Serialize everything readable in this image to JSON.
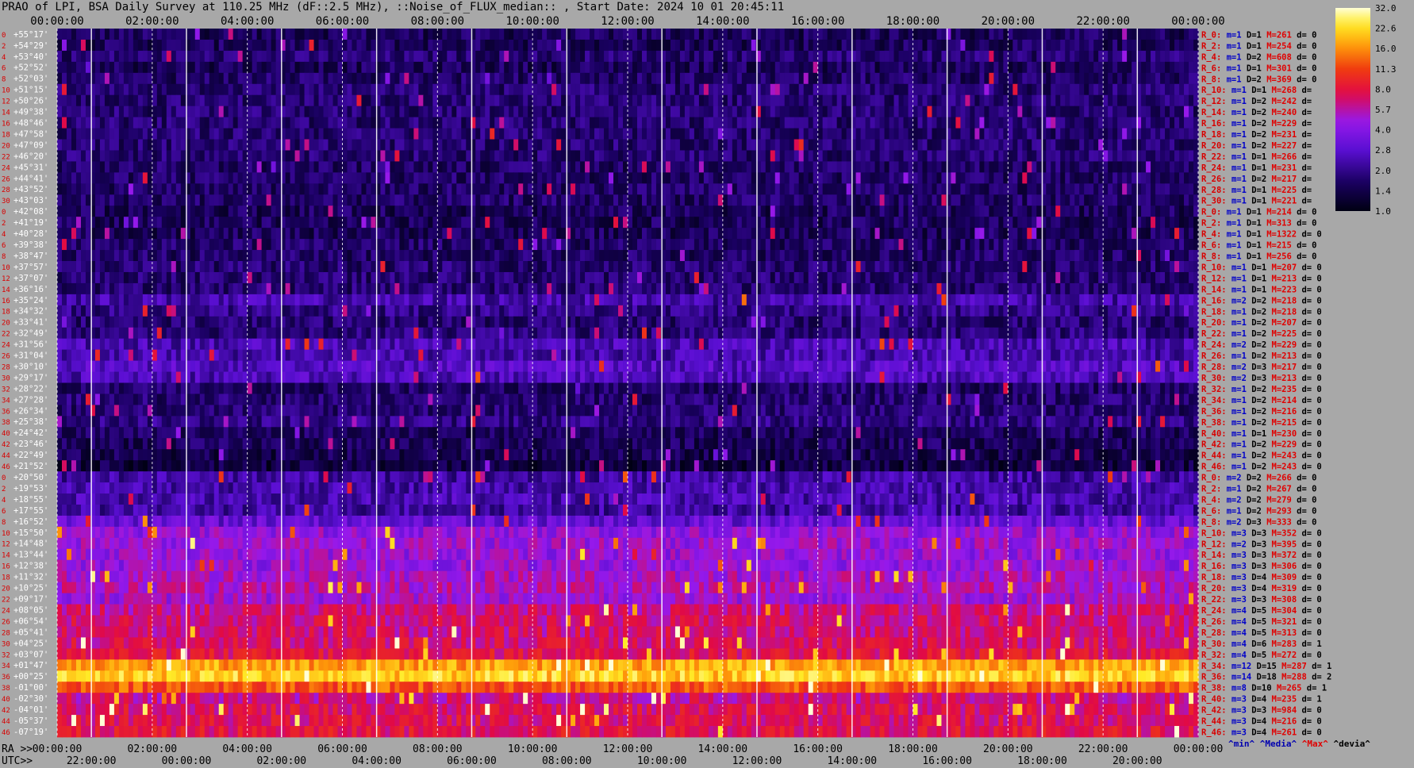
{
  "window_title": "PRAO of LPI, BSA Daily Survey at 110.25 MHz (dF::2.5 MHz), ::Noise_of_FLUX_median:: , Start Date: 2024 10 01 20:45:11",
  "chart_data": {
    "type": "heatmap",
    "title": "PRAO of LPI, BSA Daily Survey at 110.25 MHz (dF::2.5 MHz), ::Noise_of_FLUX_median:: , Start Date: 2024 10 01 20:45:11",
    "top_time_labels": [
      "00:00:00",
      "02:00:00",
      "04:00:00",
      "06:00:00",
      "08:00:00",
      "10:00:00",
      "12:00:00",
      "14:00:00",
      "16:00:00",
      "18:00:00",
      "20:00:00",
      "22:00:00",
      "00:00:00"
    ],
    "ra_axis_label": "RA >>",
    "ra_labels": [
      "00:00:00",
      "02:00:00",
      "04:00:00",
      "06:00:00",
      "08:00:00",
      "10:00:00",
      "12:00:00",
      "14:00:00",
      "16:00:00",
      "18:00:00",
      "20:00:00",
      "22:00:00",
      "00:00:00"
    ],
    "utc_axis_label": "UTC>>",
    "utc_labels": [
      "22:00:00",
      "00:00:00",
      "02:00:00",
      "04:00:00",
      "06:00:00",
      "08:00:00",
      "10:00:00",
      "12:00:00",
      "14:00:00",
      "16:00:00",
      "18:00:00",
      "20:00:00"
    ],
    "dec_labels": [
      "+55°17'",
      "+54°29'",
      "+53°40'",
      "+52°52'",
      "+52°03'",
      "+51°15'",
      "+50°26'",
      "+49°38'",
      "+48°46'",
      "+47°58'",
      "+47°09'",
      "+46°20'",
      "+45°31'",
      "+44°41'",
      "+43°52'",
      "+43°03'",
      "+42°08'",
      "+41°19'",
      "+40°28'",
      "+39°38'",
      "+38°47'",
      "+37°57'",
      "+37°07'",
      "+36°16'",
      "+35°24'",
      "+34°32'",
      "+33°41'",
      "+32°49'",
      "+31°56'",
      "+31°04'",
      "+30°10'",
      "+29°17'",
      "+28°22'",
      "+27°28'",
      "+26°34'",
      "+25°38'",
      "+24°42'",
      "+23°46'",
      "+22°49'",
      "+21°52'",
      "+20°50'",
      "+19°53'",
      "+18°55'",
      "+17°55'",
      "+16°52'",
      "+15°50'",
      "+14°48'",
      "+13°44'",
      "+12°38'",
      "+11°32'",
      "+10°25'",
      "+09°17'",
      "+08°05'",
      "+06°54'",
      "+05°41'",
      "+04°25'",
      "+03°07'",
      "+01°47'",
      "+00°25'",
      "-01°00'",
      "-02°30'",
      "-04°01'",
      "-05°37'",
      "-07°19'"
    ],
    "beam_index_labels": [
      "0",
      "2",
      "4",
      "6",
      "8",
      "10",
      "12",
      "14",
      "16",
      "18",
      "20",
      "22",
      "24",
      "26",
      "28",
      "30",
      "0",
      "2",
      "4",
      "6",
      "8",
      "10",
      "12",
      "14",
      "16",
      "18",
      "20",
      "22",
      "24",
      "26",
      "28",
      "30",
      "32",
      "34",
      "36",
      "38",
      "40",
      "42",
      "44",
      "46",
      "0",
      "2",
      "4",
      "6",
      "8",
      "10",
      "12",
      "14",
      "16",
      "18",
      "20",
      "22",
      "24",
      "26",
      "28",
      "30",
      "32",
      "34",
      "36",
      "38",
      "40",
      "42",
      "44",
      "46"
    ],
    "stats": [
      {
        "r": "R_0:",
        "m": "m=1",
        "d": "D=1",
        "max": "M=261",
        "dev": "d= 0"
      },
      {
        "r": "R_2:",
        "m": "m=1",
        "d": "D=1",
        "max": "M=254",
        "dev": "d= 0"
      },
      {
        "r": "R_4:",
        "m": "m=1",
        "d": "D=2",
        "max": "M=608",
        "dev": "d= 0"
      },
      {
        "r": "R_6:",
        "m": "m=1",
        "d": "D=1",
        "max": "M=301",
        "dev": "d= 0"
      },
      {
        "r": "R_8:",
        "m": "m=1",
        "d": "D=2",
        "max": "M=369",
        "dev": "d= 0"
      },
      {
        "r": "R_10:",
        "m": "m=1",
        "d": "D=1",
        "max": "M=268",
        "dev": "d="
      },
      {
        "r": "R_12:",
        "m": "m=1",
        "d": "D=2",
        "max": "M=242",
        "dev": "d="
      },
      {
        "r": "R_14:",
        "m": "m=1",
        "d": "D=2",
        "max": "M=240",
        "dev": "d="
      },
      {
        "r": "R_16:",
        "m": "m=1",
        "d": "D=2",
        "max": "M=229",
        "dev": "d="
      },
      {
        "r": "R_18:",
        "m": "m=1",
        "d": "D=2",
        "max": "M=231",
        "dev": "d="
      },
      {
        "r": "R_20:",
        "m": "m=1",
        "d": "D=2",
        "max": "M=227",
        "dev": "d="
      },
      {
        "r": "R_22:",
        "m": "m=1",
        "d": "D=1",
        "max": "M=266",
        "dev": "d="
      },
      {
        "r": "R_24:",
        "m": "m=1",
        "d": "D=1",
        "max": "M=231",
        "dev": "d="
      },
      {
        "r": "R_26:",
        "m": "m=1",
        "d": "D=2",
        "max": "M=217",
        "dev": "d="
      },
      {
        "r": "R_28:",
        "m": "m=1",
        "d": "D=1",
        "max": "M=225",
        "dev": "d="
      },
      {
        "r": "R_30:",
        "m": "m=1",
        "d": "D=1",
        "max": "M=221",
        "dev": "d="
      },
      {
        "r": "R_0:",
        "m": "m=1",
        "d": "D=1",
        "max": "M=214",
        "dev": "d= 0"
      },
      {
        "r": "R_2:",
        "m": "m=1",
        "d": "D=1",
        "max": "M=313",
        "dev": "d= 0"
      },
      {
        "r": "R_4:",
        "m": "m=1",
        "d": "D=1",
        "max": "M=1322",
        "dev": "d= 0"
      },
      {
        "r": "R_6:",
        "m": "m=1",
        "d": "D=1",
        "max": "M=215",
        "dev": "d= 0"
      },
      {
        "r": "R_8:",
        "m": "m=1",
        "d": "D=1",
        "max": "M=256",
        "dev": "d= 0"
      },
      {
        "r": "R_10:",
        "m": "m=1",
        "d": "D=1",
        "max": "M=207",
        "dev": "d= 0"
      },
      {
        "r": "R_12:",
        "m": "m=1",
        "d": "D=1",
        "max": "M=213",
        "dev": "d= 0"
      },
      {
        "r": "R_14:",
        "m": "m=1",
        "d": "D=1",
        "max": "M=223",
        "dev": "d= 0"
      },
      {
        "r": "R_16:",
        "m": "m=2",
        "d": "D=2",
        "max": "M=218",
        "dev": "d= 0"
      },
      {
        "r": "R_18:",
        "m": "m=1",
        "d": "D=2",
        "max": "M=218",
        "dev": "d= 0"
      },
      {
        "r": "R_20:",
        "m": "m=1",
        "d": "D=2",
        "max": "M=207",
        "dev": "d= 0"
      },
      {
        "r": "R_22:",
        "m": "m=1",
        "d": "D=2",
        "max": "M=225",
        "dev": "d= 0"
      },
      {
        "r": "R_24:",
        "m": "m=2",
        "d": "D=2",
        "max": "M=229",
        "dev": "d= 0"
      },
      {
        "r": "R_26:",
        "m": "m=1",
        "d": "D=2",
        "max": "M=213",
        "dev": "d= 0"
      },
      {
        "r": "R_28:",
        "m": "m=2",
        "d": "D=3",
        "max": "M=217",
        "dev": "d= 0"
      },
      {
        "r": "R_30:",
        "m": "m=2",
        "d": "D=3",
        "max": "M=213",
        "dev": "d= 0"
      },
      {
        "r": "R_32:",
        "m": "m=1",
        "d": "D=2",
        "max": "M=235",
        "dev": "d= 0"
      },
      {
        "r": "R_34:",
        "m": "m=1",
        "d": "D=2",
        "max": "M=214",
        "dev": "d= 0"
      },
      {
        "r": "R_36:",
        "m": "m=1",
        "d": "D=2",
        "max": "M=216",
        "dev": "d= 0"
      },
      {
        "r": "R_38:",
        "m": "m=1",
        "d": "D=2",
        "max": "M=215",
        "dev": "d= 0"
      },
      {
        "r": "R_40:",
        "m": "m=1",
        "d": "D=1",
        "max": "M=230",
        "dev": "d= 0"
      },
      {
        "r": "R_42:",
        "m": "m=1",
        "d": "D=2",
        "max": "M=229",
        "dev": "d= 0"
      },
      {
        "r": "R_44:",
        "m": "m=1",
        "d": "D=2",
        "max": "M=243",
        "dev": "d= 0"
      },
      {
        "r": "R_46:",
        "m": "m=1",
        "d": "D=2",
        "max": "M=243",
        "dev": "d= 0"
      },
      {
        "r": "R_0:",
        "m": "m=2",
        "d": "D=2",
        "max": "M=266",
        "dev": "d= 0"
      },
      {
        "r": "R_2:",
        "m": "m=1",
        "d": "D=2",
        "max": "M=267",
        "dev": "d= 0"
      },
      {
        "r": "R_4:",
        "m": "m=2",
        "d": "D=2",
        "max": "M=279",
        "dev": "d= 0"
      },
      {
        "r": "R_6:",
        "m": "m=1",
        "d": "D=2",
        "max": "M=293",
        "dev": "d= 0"
      },
      {
        "r": "R_8:",
        "m": "m=2",
        "d": "D=3",
        "max": "M=333",
        "dev": "d= 0"
      },
      {
        "r": "R_10:",
        "m": "m=3",
        "d": "D=3",
        "max": "M=352",
        "dev": "d= 0"
      },
      {
        "r": "R_12:",
        "m": "m=2",
        "d": "D=3",
        "max": "M=395",
        "dev": "d= 0"
      },
      {
        "r": "R_14:",
        "m": "m=3",
        "d": "D=3",
        "max": "M=372",
        "dev": "d= 0"
      },
      {
        "r": "R_16:",
        "m": "m=3",
        "d": "D=3",
        "max": "M=306",
        "dev": "d= 0"
      },
      {
        "r": "R_18:",
        "m": "m=3",
        "d": "D=4",
        "max": "M=309",
        "dev": "d= 0"
      },
      {
        "r": "R_20:",
        "m": "m=3",
        "d": "D=4",
        "max": "M=319",
        "dev": "d= 0"
      },
      {
        "r": "R_22:",
        "m": "m=3",
        "d": "D=3",
        "max": "M=308",
        "dev": "d= 0"
      },
      {
        "r": "R_24:",
        "m": "m=4",
        "d": "D=5",
        "max": "M=304",
        "dev": "d= 0"
      },
      {
        "r": "R_26:",
        "m": "m=4",
        "d": "D=5",
        "max": "M=321",
        "dev": "d= 0"
      },
      {
        "r": "R_28:",
        "m": "m=4",
        "d": "D=5",
        "max": "M=313",
        "dev": "d= 0"
      },
      {
        "r": "R_30:",
        "m": "m=4",
        "d": "D=6",
        "max": "M=283",
        "dev": "d= 1"
      },
      {
        "r": "R_32:",
        "m": "m=4",
        "d": "D=5",
        "max": "M=272",
        "dev": "d= 0"
      },
      {
        "r": "R_34:",
        "m": "m=12",
        "d": "D=15",
        "max": "M=287",
        "dev": "d= 1"
      },
      {
        "r": "R_36:",
        "m": "m=14",
        "d": "D=18",
        "max": "M=288",
        "dev": "d= 2"
      },
      {
        "r": "R_38:",
        "m": "m=8",
        "d": "D=10",
        "max": "M=265",
        "dev": "d= 1"
      },
      {
        "r": "R_40:",
        "m": "m=3",
        "d": "D=4",
        "max": "M=235",
        "dev": "d= 1"
      },
      {
        "r": "R_42:",
        "m": "m=3",
        "d": "D=3",
        "max": "M=984",
        "dev": "d= 0"
      },
      {
        "r": "R_44:",
        "m": "m=3",
        "d": "D=4",
        "max": "M=216",
        "dev": "d= 0"
      },
      {
        "r": "R_46:",
        "m": "m=3",
        "d": "D=4",
        "max": "M=261",
        "dev": "d= 0"
      }
    ],
    "stats_footer": {
      "min": "^min^",
      "median": "^Media^",
      "max": "^Max^",
      "dev": "^devia^"
    },
    "colorbar_ticks": [
      "32.0",
      "22.6",
      "16.0",
      "11.3",
      "8.0",
      "5.7",
      "4.0",
      "2.8",
      "2.0",
      "1.4",
      "1.0"
    ],
    "row_level_profile": [
      1.6,
      1.6,
      1.8,
      1.6,
      1.7,
      1.8,
      1.8,
      1.8,
      1.8,
      1.8,
      1.8,
      1.8,
      1.7,
      1.7,
      1.7,
      1.7,
      1.6,
      1.6,
      1.6,
      1.7,
      1.7,
      1.8,
      1.8,
      1.8,
      2.4,
      2.0,
      1.8,
      1.9,
      2.5,
      2.4,
      2.8,
      2.6,
      1.7,
      1.8,
      1.8,
      2.0,
      1.6,
      1.6,
      1.5,
      1.4,
      2.3,
      2.4,
      2.5,
      2.3,
      3.2,
      4.5,
      4.8,
      4.6,
      4.6,
      5.2,
      5.5,
      4.9,
      6.5,
      6.8,
      6.8,
      7.2,
      8.0,
      18,
      22,
      13,
      6.5,
      7.5,
      7.5,
      8.0
    ],
    "colors": {
      "background": "#a8a8a8",
      "grid_solid": "#ffffff",
      "grid_dashed": "#ffffff",
      "r_label": "#d80000",
      "m_label": "#0000c8",
      "d_label": "#000000",
      "max_label": "#e00000",
      "dec_label": "#ffffff",
      "footer_max": "#e00000",
      "footer_other": "#0000b0"
    }
  }
}
